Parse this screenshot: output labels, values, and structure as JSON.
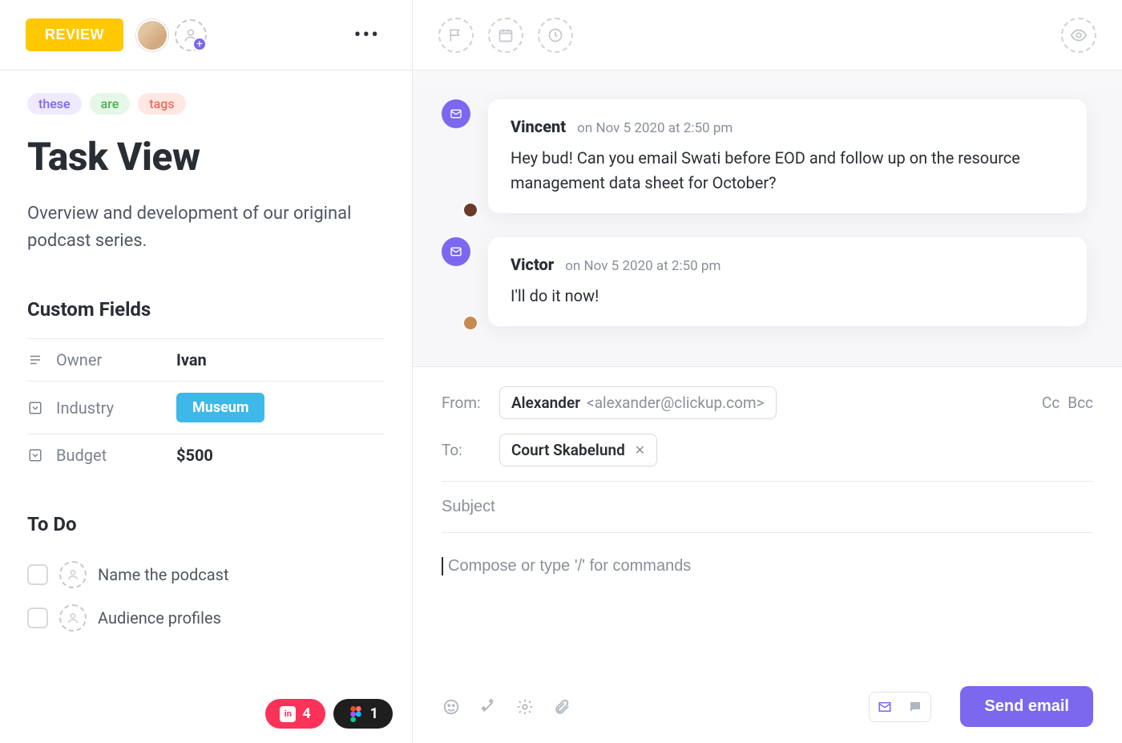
{
  "header": {
    "status_button": "REVIEW"
  },
  "tags": [
    {
      "label": "these",
      "bg": "#efeafe",
      "fg": "#7b68ee"
    },
    {
      "label": "are",
      "bg": "#e4f7e8",
      "fg": "#4caf50"
    },
    {
      "label": "tags",
      "bg": "#ffe7e4",
      "fg": "#f46a55"
    }
  ],
  "task": {
    "title": "Task View",
    "description": "Overview and development of our original podcast series."
  },
  "custom_fields": {
    "heading": "Custom Fields",
    "rows": [
      {
        "icon": "text",
        "label": "Owner",
        "value": "Ivan",
        "type": "text"
      },
      {
        "icon": "dropdown",
        "label": "Industry",
        "value": "Museum",
        "type": "pill"
      },
      {
        "icon": "dropdown",
        "label": "Budget",
        "value": "$500",
        "type": "text"
      }
    ]
  },
  "todo": {
    "heading": "To Do",
    "items": [
      {
        "label": "Name the podcast"
      },
      {
        "label": "Audience profiles"
      }
    ]
  },
  "attachments": [
    {
      "app": "invision",
      "count": "4",
      "bg": "#fd3259"
    },
    {
      "app": "figma",
      "count": "1",
      "bg": "#1e1e1e"
    }
  ],
  "messages": [
    {
      "author": "Vincent",
      "timestamp": "on Nov 5 2020 at 2:50 pm",
      "body": "Hey bud! Can you email Swati before EOD and follow up on the resource management data sheet for October?",
      "avatar_bg": "#6b3a2a"
    },
    {
      "author": "Victor",
      "timestamp": "on Nov 5 2020 at 2:50 pm",
      "body": "I'll do it now!",
      "avatar_bg": "#c98a50"
    }
  ],
  "compose": {
    "from_label": "From:",
    "from_name": "Alexander",
    "from_email": "<alexander@clickup.com>",
    "to_label": "To:",
    "to_name": "Court Skabelund",
    "cc_label": "Cc",
    "bcc_label": "Bcc",
    "subject_placeholder": "Subject",
    "body_placeholder": "Compose or type '/' for commands",
    "send_label": "Send email"
  }
}
